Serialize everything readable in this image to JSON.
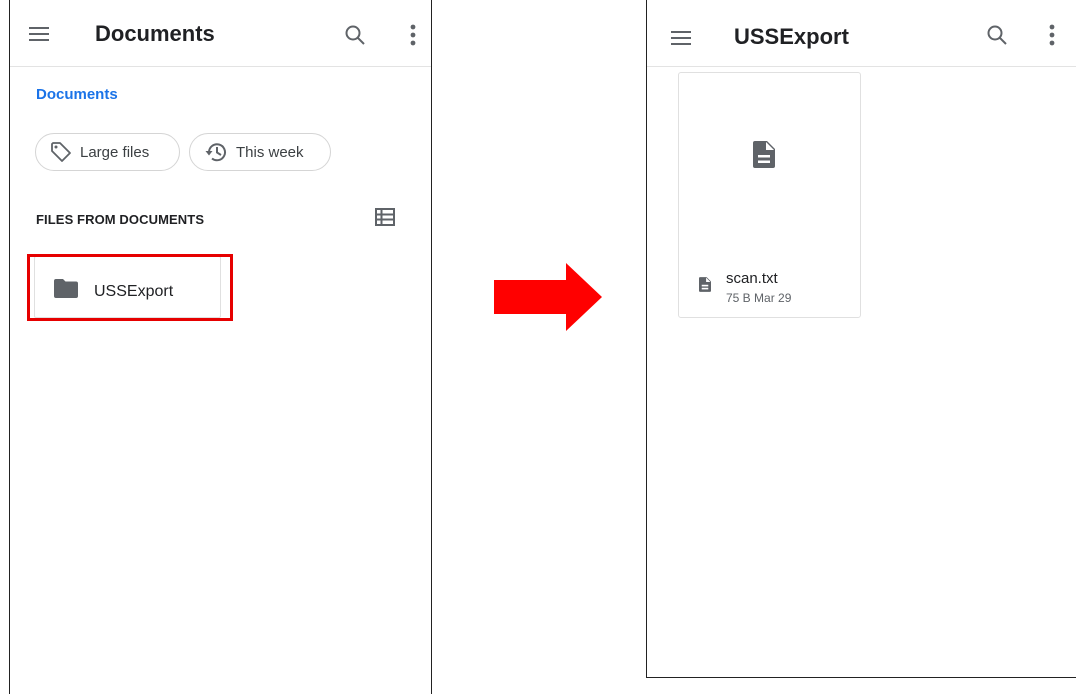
{
  "left_screen": {
    "appbar": {
      "title": "Documents",
      "menu_icon": "hamburger-menu-icon",
      "search_icon": "search-icon",
      "more_icon": "more-vert-icon"
    },
    "breadcrumb": "Documents",
    "chips": [
      {
        "label": "Large files",
        "icon": "tag-icon"
      },
      {
        "label": "This week",
        "icon": "history-icon"
      }
    ],
    "section_header": "FILES FROM DOCUMENTS",
    "view_toggle_icon": "list-view-icon",
    "folder": {
      "name": "USSExport",
      "icon": "folder-icon"
    }
  },
  "right_screen": {
    "appbar": {
      "title": "USSExport",
      "menu_icon": "hamburger-menu-icon",
      "search_icon": "search-icon",
      "more_icon": "more-vert-icon"
    },
    "file": {
      "name": "scan.txt",
      "meta": "75 B Mar 29",
      "icon": "document-icon"
    }
  },
  "colors": {
    "accent_blue": "#1a73e8",
    "highlight_red": "#e60000",
    "icon_gray": "#5f6368",
    "text_dark": "#202124"
  }
}
